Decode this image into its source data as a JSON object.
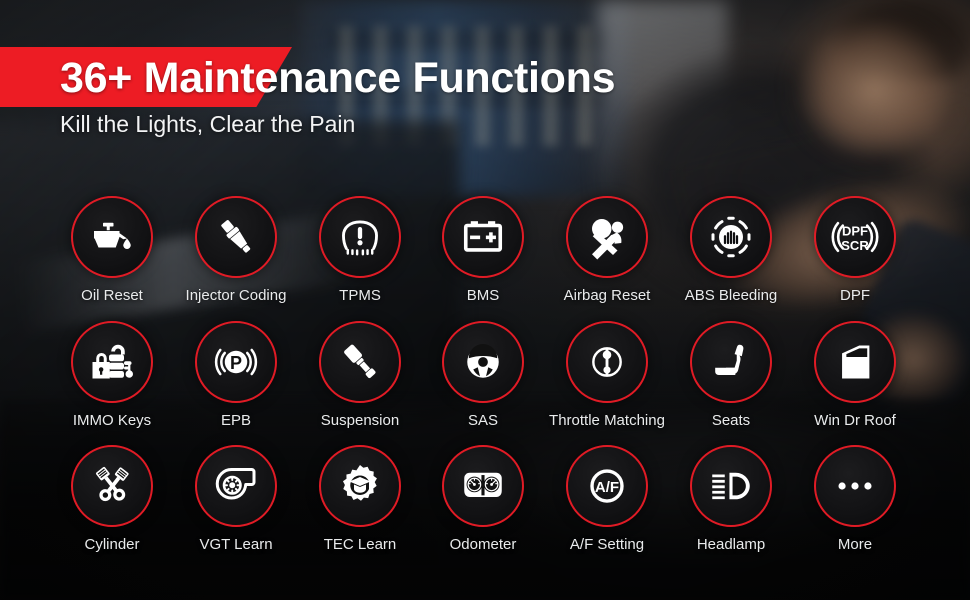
{
  "header": {
    "headline": "36+ Maintenance Functions",
    "subhead": "Kill the Lights, Clear the Pain",
    "banner_color": "#ed1c24"
  },
  "theme": {
    "accent_red": "#e01b25",
    "circle_fill": "#121214",
    "label_color": "#e9ebec"
  },
  "grid": {
    "columns": 7,
    "rows": 3,
    "items": [
      {
        "label": "Oil Reset",
        "icon": "oil-can-icon"
      },
      {
        "label": "Injector Coding",
        "icon": "fuel-injector-icon"
      },
      {
        "label": "TPMS",
        "icon": "tire-pressure-icon"
      },
      {
        "label": "BMS",
        "icon": "battery-icon"
      },
      {
        "label": "Airbag Reset",
        "icon": "airbag-seatbelt-icon"
      },
      {
        "label": "ABS Bleeding",
        "icon": "abs-brake-icon"
      },
      {
        "label": "DPF",
        "icon": "dpf-scr-icon",
        "glyph_top": "DPF",
        "glyph_bottom": "SCR"
      },
      {
        "label": "IMMO Keys",
        "icon": "lock-and-key-icon"
      },
      {
        "label": "EPB",
        "icon": "electric-parking-brake-icon",
        "glyph": "P"
      },
      {
        "label": "Suspension",
        "icon": "shock-absorber-icon"
      },
      {
        "label": "SAS",
        "icon": "steering-wheel-icon"
      },
      {
        "label": "Throttle Matching",
        "icon": "throttle-body-icon"
      },
      {
        "label": "Seats",
        "icon": "car-seat-icon"
      },
      {
        "label": "Win Dr Roof",
        "icon": "car-door-icon"
      },
      {
        "label": "Cylinder",
        "icon": "crossed-pistons-icon"
      },
      {
        "label": "VGT Learn",
        "icon": "turbocharger-icon"
      },
      {
        "label": "TEC Learn",
        "icon": "gear-graduation-cap-icon"
      },
      {
        "label": "Odometer",
        "icon": "instrument-cluster-icon"
      },
      {
        "label": "A/F Setting",
        "icon": "air-fuel-icon",
        "glyph": "A/F"
      },
      {
        "label": "Headlamp",
        "icon": "headlamp-beam-icon"
      },
      {
        "label": "More",
        "icon": "ellipsis-icon"
      }
    ]
  }
}
